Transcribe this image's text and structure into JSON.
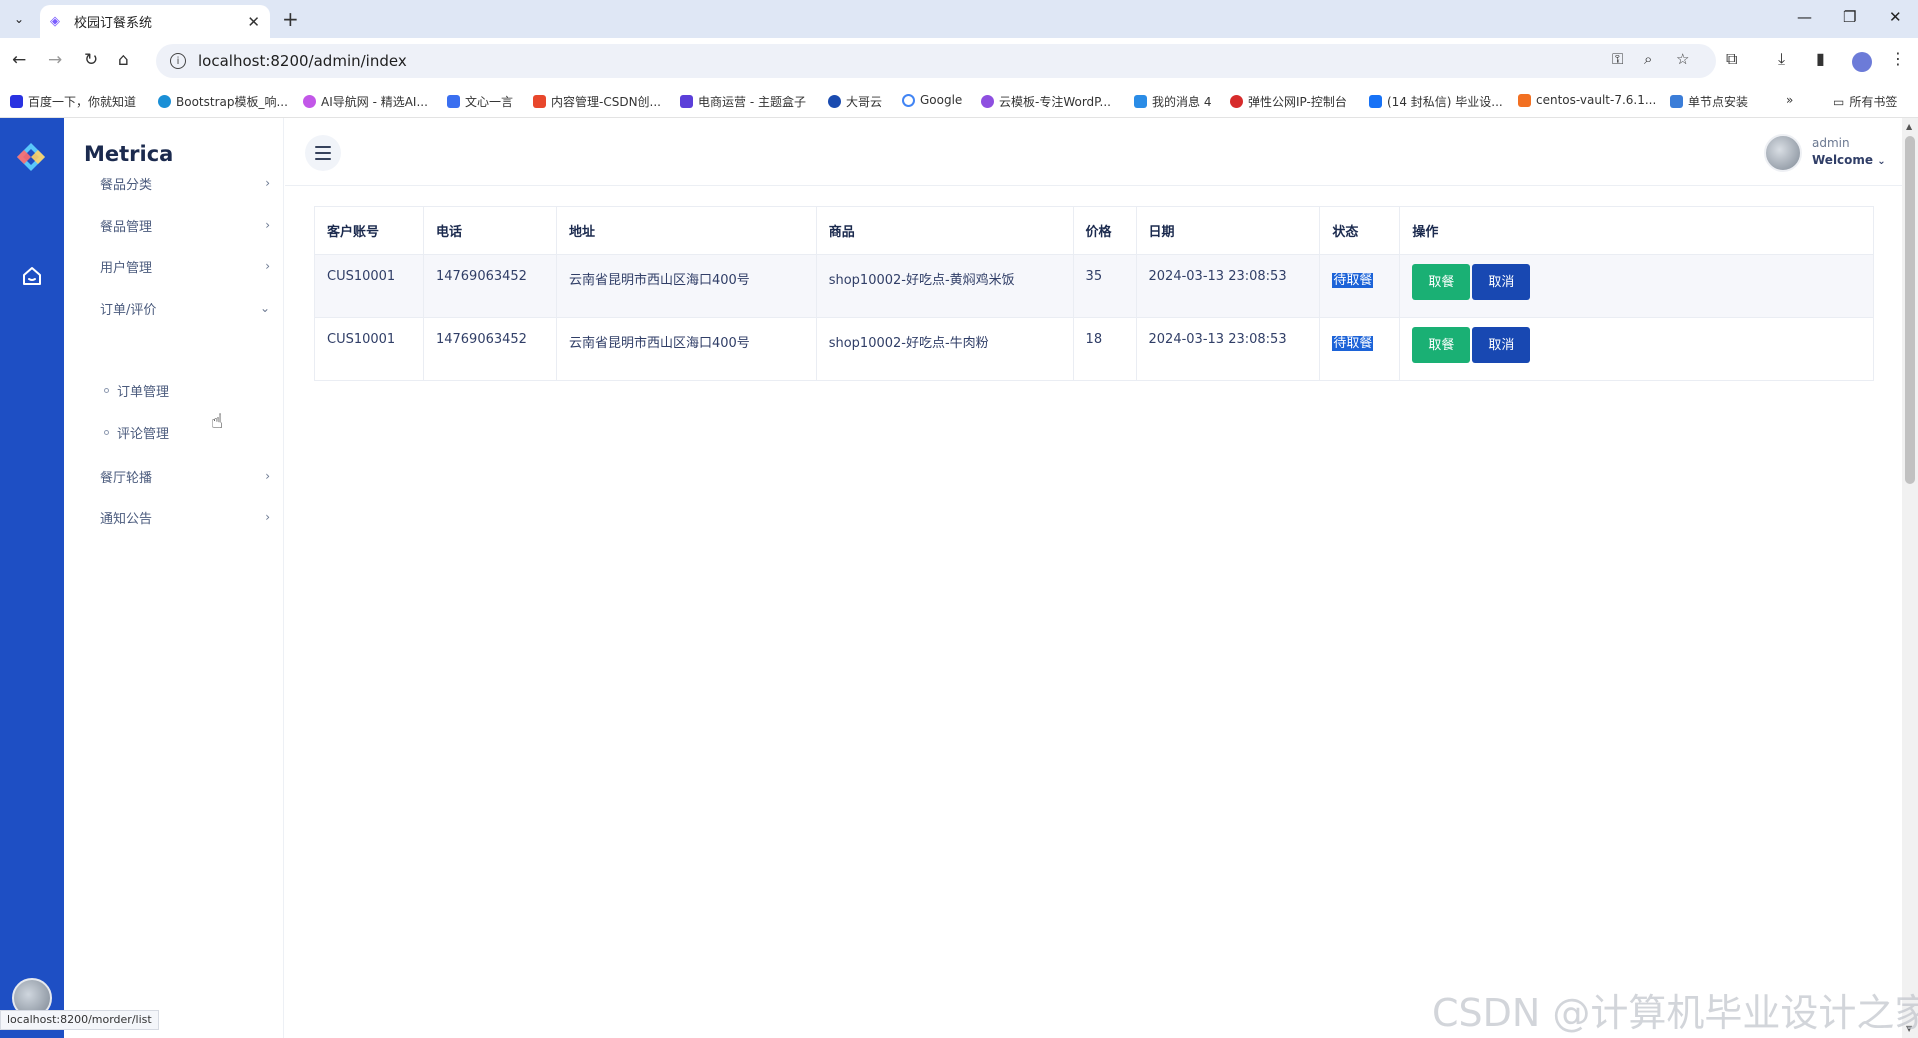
{
  "browser": {
    "tab_title": "校园订餐系统",
    "url": "localhost:8200/admin/index",
    "bookmarks": [
      "百度一下，你就知道",
      "Bootstrap模板_响...",
      "AI导航网 - 精选AI...",
      "文心一言",
      "内容管理-CSDN创...",
      "电商运营 - 主题盒子",
      "大哥云",
      "Google",
      "云模板-专注WordP...",
      "我的消息 4",
      "弹性公网IP-控制台",
      "(14 封私信) 毕业设...",
      "centos-vault-7.6.1...",
      "单节点安装"
    ],
    "all_bookmarks": "所有书签",
    "status_url": "localhost:8200/morder/list"
  },
  "sidebar": {
    "brand": "Metrica",
    "items": [
      {
        "label": "餐品分类"
      },
      {
        "label": "餐品管理"
      },
      {
        "label": "用户管理"
      },
      {
        "label": "订单/评价"
      },
      {
        "label": "餐厅轮播"
      },
      {
        "label": "通知公告"
      }
    ],
    "sub_items": [
      {
        "label": "订单管理"
      },
      {
        "label": "评论管理"
      }
    ]
  },
  "topbar": {
    "user_name": "admin",
    "welcome": "Welcome"
  },
  "table": {
    "headers": [
      "客户账号",
      "电话",
      "地址",
      "商品",
      "价格",
      "日期",
      "状态",
      "操作"
    ],
    "rows": [
      {
        "account": "CUS10001",
        "phone": "14769063452",
        "address": "云南省昆明市西山区海口400号",
        "product": "shop10002-好吃点-黄焖鸡米饭",
        "price": "35",
        "date": "2024-03-13 23:08:53",
        "status": "待取餐"
      },
      {
        "account": "CUS10001",
        "phone": "14769063452",
        "address": "云南省昆明市西山区海口400号",
        "product": "shop10002-好吃点-牛肉粉",
        "price": "18",
        "date": "2024-03-13 23:08:53",
        "status": "待取餐"
      }
    ],
    "actions": {
      "pickup": "取餐",
      "cancel": "取消"
    }
  },
  "watermark": "CSDN @计算机毕业设计之家",
  "colors": {
    "leftbar": "#1e4fc4",
    "pickup_button": "#1ab074",
    "cancel_button": "#1848b2",
    "status_highlight": "#1c63d8"
  }
}
